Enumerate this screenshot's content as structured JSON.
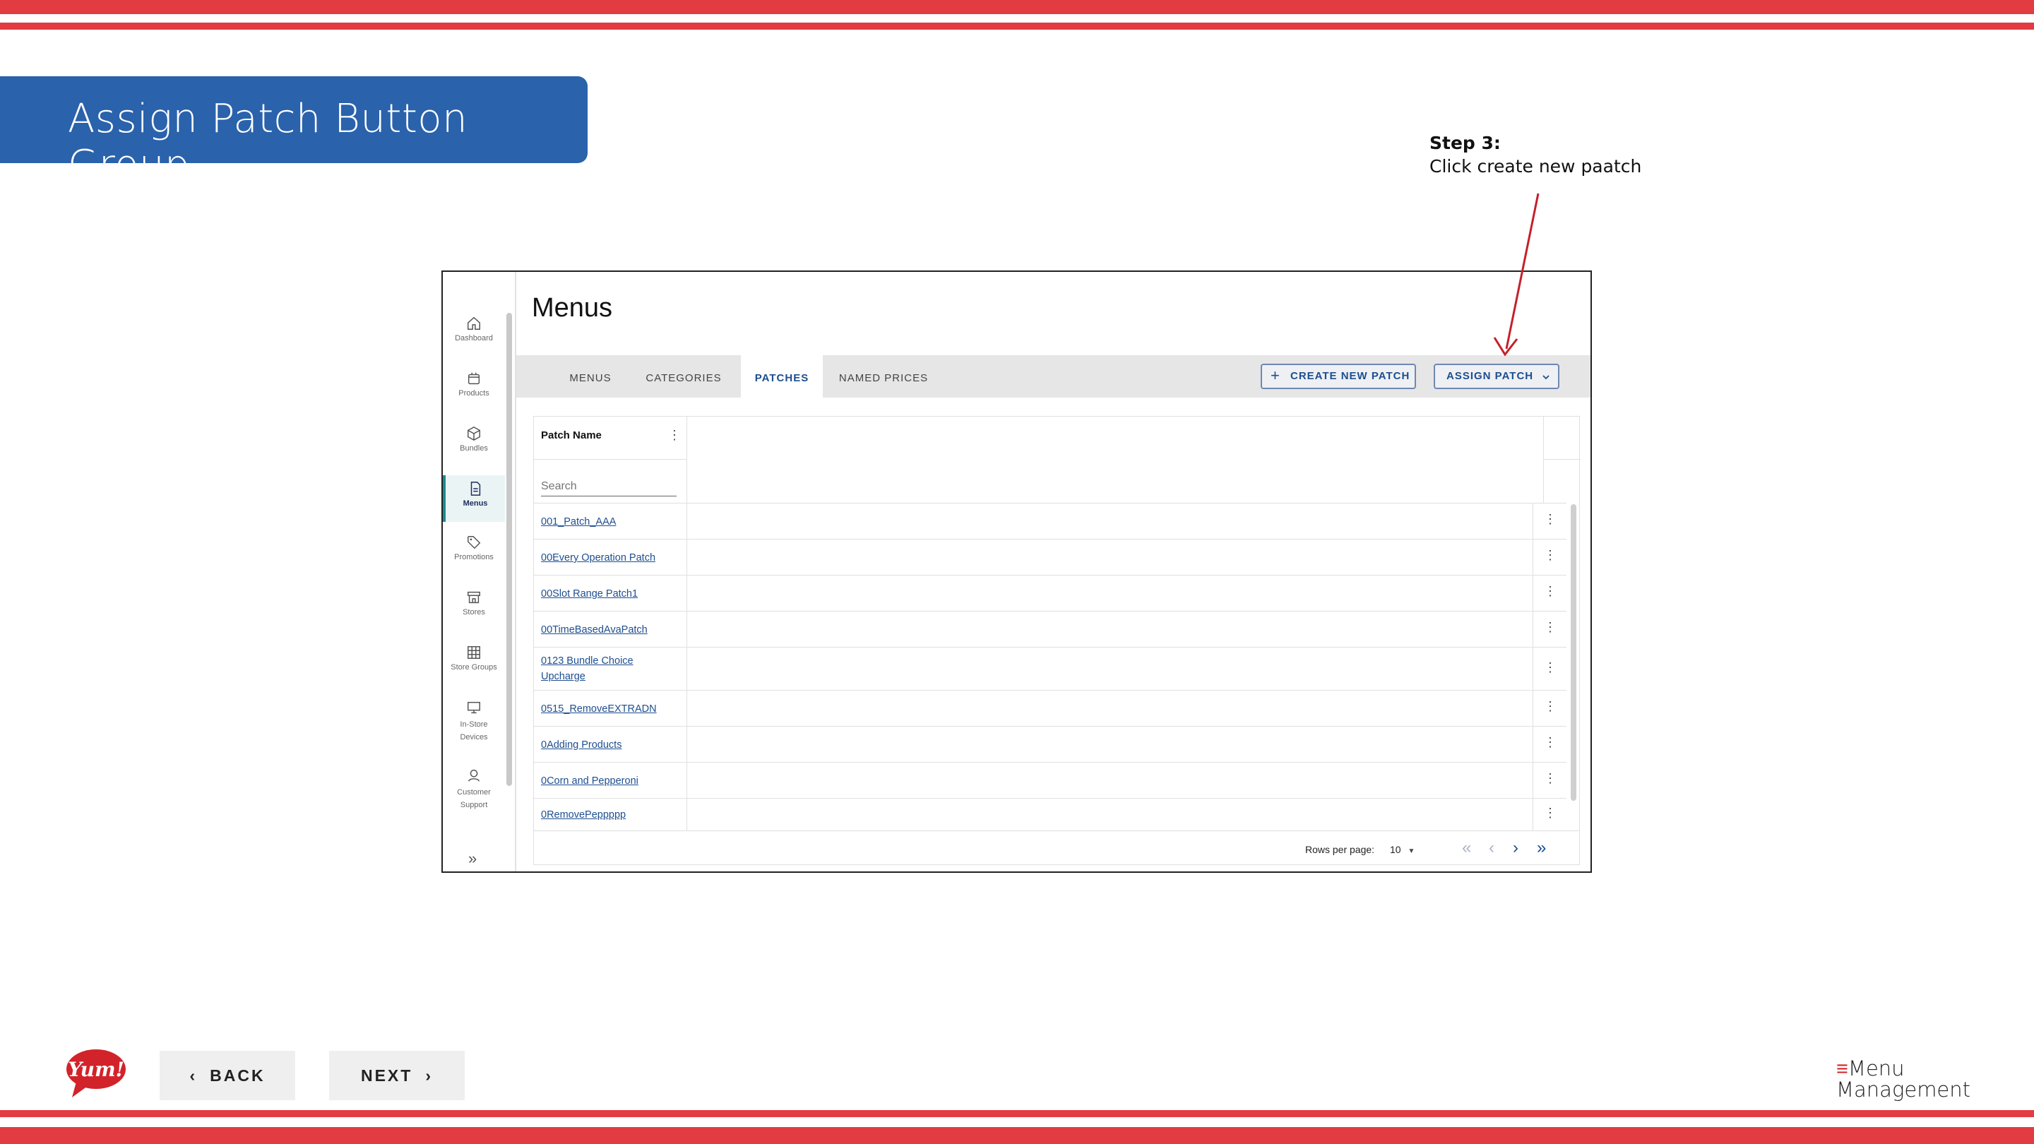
{
  "slide": {
    "title": "Assign Patch Button Group",
    "step_label": "Step 3:",
    "step_text": "Click create new paatch",
    "back_label": "BACK",
    "next_label": "NEXT",
    "yum_logo_text": "Yum!",
    "mm_logo_line1": "Menu",
    "mm_logo_line2": "Management",
    "accent_red": "#e23b41",
    "banner_blue": "#2a62ac"
  },
  "sidebar": {
    "items": [
      {
        "label": "Dashboard",
        "icon": "home-icon"
      },
      {
        "label": "Products",
        "icon": "box-icon"
      },
      {
        "label": "Bundles",
        "icon": "cube-icon"
      },
      {
        "label": "Menus",
        "icon": "document-icon"
      },
      {
        "label": "Promotions",
        "icon": "tag-icon"
      },
      {
        "label": "Stores",
        "icon": "store-icon"
      },
      {
        "label": "Store Groups",
        "icon": "grid-icon"
      },
      {
        "label": "In-Store Devices",
        "icon": "monitor-icon"
      },
      {
        "label": "Customer Support",
        "icon": "support-icon"
      }
    ],
    "active": "Menus"
  },
  "app": {
    "page_title": "Menus",
    "tabs": [
      "MENUS",
      "CATEGORIES",
      "PATCHES",
      "NAMED PRICES"
    ],
    "active_tab": "PATCHES",
    "create_button": "CREATE NEW PATCH",
    "assign_button": "ASSIGN PATCH"
  },
  "table": {
    "column_header": "Patch Name",
    "search_placeholder": "Search",
    "rows": [
      "001_Patch_AAA",
      "00Every Operation Patch",
      "00Slot Range Patch1",
      "00TimeBasedAvaPatch",
      "0123 Bundle Choice Upcharge",
      "0515_RemoveEXTRADN",
      "0Adding Products",
      "0Corn and Pepperoni",
      "0RemovePeppppp"
    ],
    "rows_per_page_label": "Rows per page:",
    "rows_per_page_value": "10"
  }
}
